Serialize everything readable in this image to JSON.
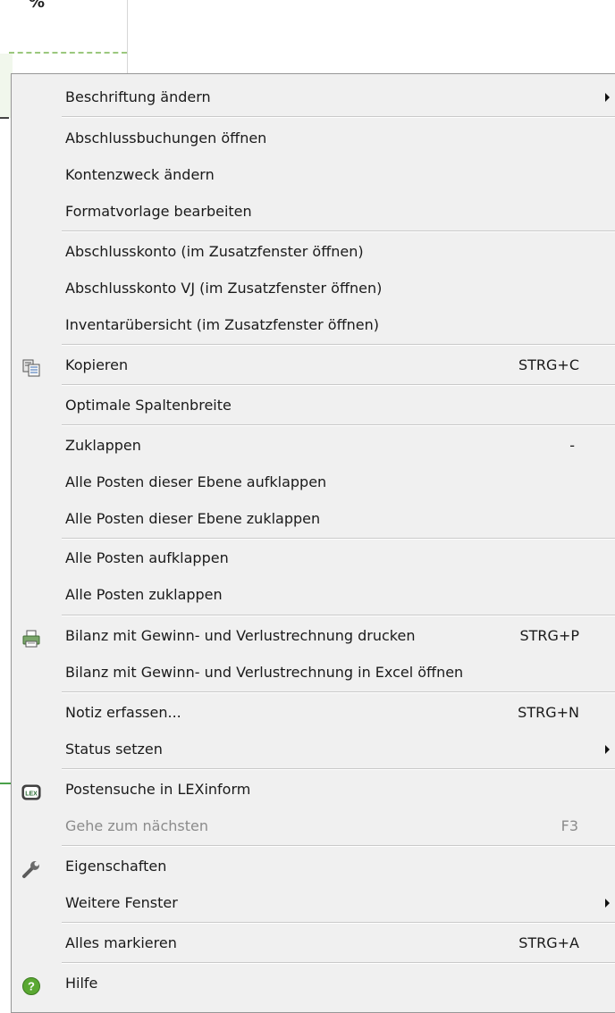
{
  "background": {
    "fragment_text": "%"
  },
  "menu": {
    "items": [
      {
        "label": "Beschriftung ändern",
        "shortcut": "",
        "submenu": true,
        "icon": ""
      },
      {
        "label": "Abschlussbuchungen öffnen",
        "shortcut": "",
        "submenu": false,
        "icon": ""
      },
      {
        "label": "Kontenzweck ändern",
        "shortcut": "",
        "submenu": false,
        "icon": ""
      },
      {
        "label": "Formatvorlage bearbeiten",
        "shortcut": "",
        "submenu": false,
        "icon": ""
      },
      {
        "label": "Abschlusskonto (im Zusatzfenster öffnen)",
        "shortcut": "",
        "submenu": false,
        "icon": ""
      },
      {
        "label": "Abschlusskonto VJ (im Zusatzfenster öffnen)",
        "shortcut": "",
        "submenu": false,
        "icon": ""
      },
      {
        "label": "Inventarübersicht (im Zusatzfenster öffnen)",
        "shortcut": "",
        "submenu": false,
        "icon": ""
      },
      {
        "label": "Kopieren",
        "shortcut": "STRG+C",
        "submenu": false,
        "icon": "copy-icon"
      },
      {
        "label": "Optimale Spaltenbreite",
        "shortcut": "",
        "submenu": false,
        "icon": ""
      },
      {
        "label": "Zuklappen",
        "shortcut": "-",
        "submenu": false,
        "icon": ""
      },
      {
        "label": "Alle Posten dieser Ebene aufklappen",
        "shortcut": "",
        "submenu": false,
        "icon": ""
      },
      {
        "label": "Alle Posten dieser Ebene zuklappen",
        "shortcut": "",
        "submenu": false,
        "icon": ""
      },
      {
        "label": "Alle Posten aufklappen",
        "shortcut": "",
        "submenu": false,
        "icon": ""
      },
      {
        "label": "Alle Posten zuklappen",
        "shortcut": "",
        "submenu": false,
        "icon": ""
      },
      {
        "label": "Bilanz mit Gewinn- und Verlustrechnung drucken",
        "shortcut": "STRG+P",
        "submenu": false,
        "icon": "printer-icon"
      },
      {
        "label": "Bilanz mit Gewinn- und Verlustrechnung in Excel öffnen",
        "shortcut": "",
        "submenu": false,
        "icon": ""
      },
      {
        "label": "Notiz erfassen...",
        "shortcut": "STRG+N",
        "submenu": false,
        "icon": ""
      },
      {
        "label": "Status setzen",
        "shortcut": "",
        "submenu": true,
        "icon": ""
      },
      {
        "label": "Postensuche in LEXinform",
        "shortcut": "",
        "submenu": false,
        "icon": "lexinform-icon"
      },
      {
        "label": "Gehe zum nächsten",
        "shortcut": "F3",
        "submenu": false,
        "icon": "",
        "disabled": true
      },
      {
        "label": "Eigenschaften",
        "shortcut": "",
        "submenu": false,
        "icon": "wrench-icon"
      },
      {
        "label": "Weitere Fenster",
        "shortcut": "",
        "submenu": true,
        "icon": ""
      },
      {
        "label": "Alles markieren",
        "shortcut": "STRG+A",
        "submenu": false,
        "icon": ""
      },
      {
        "label": "Hilfe",
        "shortcut": "",
        "submenu": false,
        "icon": "help-icon"
      }
    ],
    "icon_texts": {
      "lexinform": "LEX",
      "help": "?"
    },
    "colors": {
      "menu_background": "#f0f0f0",
      "disabled_text": "#8b8b8b",
      "help_green": "#5aa832"
    }
  }
}
